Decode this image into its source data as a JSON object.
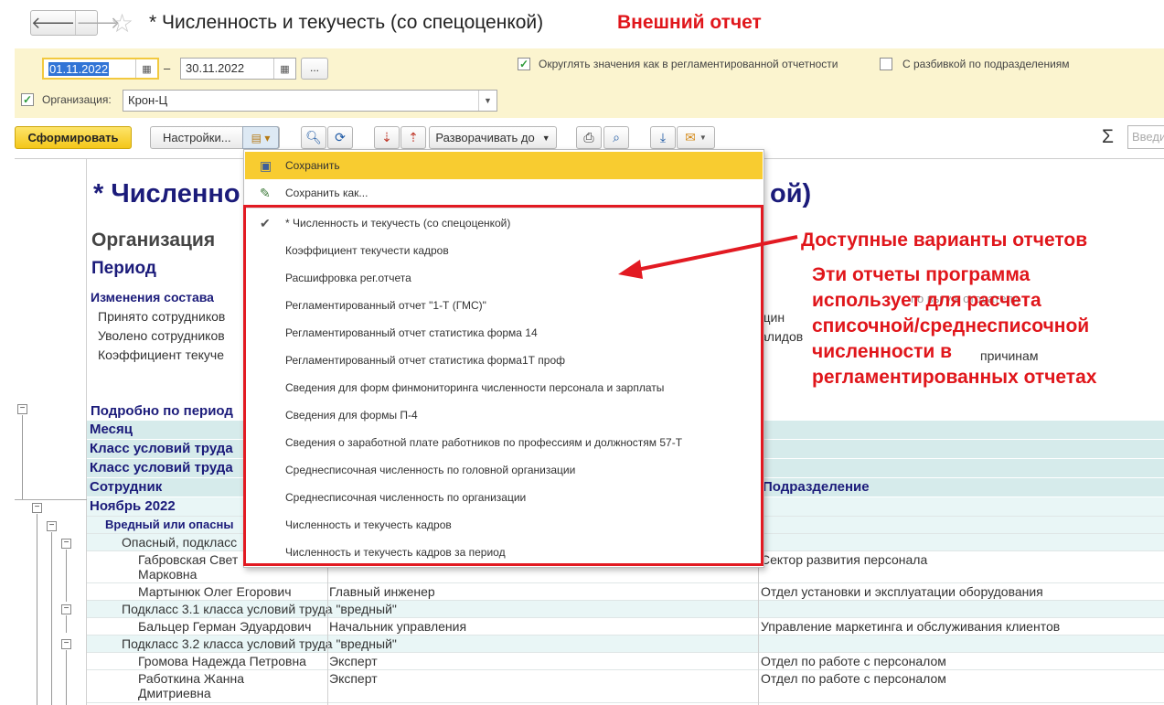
{
  "window": {
    "title": "* Численность и текучесть (со спецоценкой)",
    "external_note": "Внешний отчет",
    "nav_back": "🡐",
    "nav_forward": "🡒",
    "star": "☆"
  },
  "params": {
    "date_from": "01.11.2022",
    "date_to": "30.11.2022",
    "dash": "–",
    "dots": "...",
    "round_label": "Округлять значения как в регламентированной отчетности",
    "round_checked": true,
    "split_label": "С разбивкой по подразделениям",
    "split_checked": false,
    "org_label": "Организация:",
    "org_checked": true,
    "org_value": "Крон-Ц"
  },
  "toolbar": {
    "generate": "Сформировать",
    "settings": "Настройки...",
    "expand": "Разворачивать до",
    "sigma": "Σ",
    "search_placeholder": "Введи"
  },
  "report": {
    "title_left": "* Численно",
    "title_right": "ой)",
    "org_heading": "Организация",
    "period_heading": "Период",
    "changes_heading": "Изменения состава",
    "hired": "Принято сотрудников",
    "dismissed": "Уволено сотрудников",
    "turnover": "Коэффициент текуче",
    "right_col_a": "щин",
    "right_col_b": "алидов",
    "right_col_c": "причинам",
    "right_col_top": "по вы у к отодатели",
    "by_period": "Подробно по период",
    "headers": {
      "month": "Месяц",
      "class1": "Класс условий труда",
      "class2": "Класс условий труда",
      "employee": "Сотрудник",
      "department": "Подразделение"
    },
    "rows": [
      {
        "name": "Ноябрь 2022",
        "position": "",
        "department": ""
      },
      {
        "name": "Вредный или опасны",
        "position": "",
        "department": ""
      },
      {
        "name": "Опасный, подкласс",
        "position": "",
        "department": ""
      },
      {
        "name": "Габровская Свет",
        "name2": "Марковна",
        "position": "",
        "department": "Сектор развития персонала"
      },
      {
        "name": "Мартынюк Олег Егорович",
        "position": "Главный инженер",
        "department": "Отдел установки и эксплуатации оборудования"
      },
      {
        "name": "Подкласс 3.1 класса условий труда \"вредный\"",
        "position": "",
        "department": ""
      },
      {
        "name": "Бальцер Герман Эдуардович",
        "position": "Начальник управления",
        "department": "Управление маркетинга и обслуживания клиентов"
      },
      {
        "name": "Подкласс 3.2 класса условий труда \"вредный\"",
        "position": "",
        "department": ""
      },
      {
        "name": "Громова Надежда Петровна",
        "position": "Эксперт",
        "department": "Отдел по работе с персоналом"
      },
      {
        "name": "Работкина Жанна",
        "name2": "Дмитриевна",
        "position": "Эксперт",
        "department": "Отдел по работе с персоналом"
      }
    ]
  },
  "popup": {
    "save": "Сохранить",
    "save_as": "Сохранить как...",
    "variants": [
      "* Численность и текучесть (со спецоценкой)",
      "Коэффициент текучести кадров",
      "Расшифровка рег.отчета",
      "Регламентированный отчет \"1-Т (ГМС)\"",
      "Регламентированный отчет статистика форма 14",
      "Регламентированный отчет статистика форма1Т проф",
      "Сведения для форм финмониторинга численности персонала и зарплаты",
      "Сведения для формы П-4",
      "Сведения о заработной плате работников по профессиям и должностям 57-Т",
      "Среднесписочная численность по головной организации",
      "Среднесписочная численность по организации",
      "Численность и текучесть кадров",
      "Численность и текучесть кадров за период"
    ]
  },
  "annotations": {
    "available": "Доступные варианты отчетов",
    "line1": "Эти отчеты программа",
    "line2": "использует для расчета",
    "line3": "списочной/среднесписочной",
    "line4": "численности в",
    "line5": "регламентированных отчетах"
  },
  "colors": {
    "accent_red": "#e0161b",
    "highlight": "#f8cc30",
    "param_bg": "#fbf4cf",
    "report_blue": "#1b1b7a"
  }
}
